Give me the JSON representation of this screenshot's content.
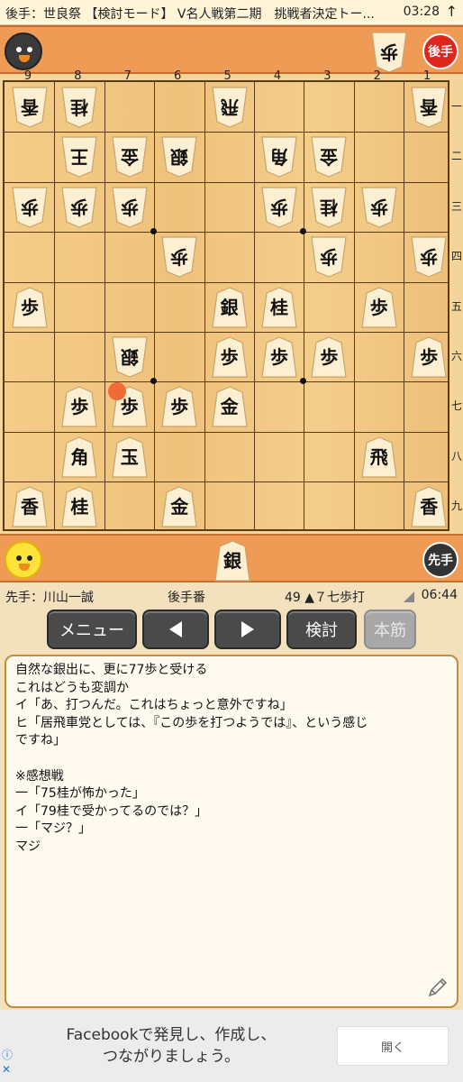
{
  "status_bar": {
    "title": "後手：世良祭 【検討モード】 V名人戦第二期　挑戦者決定トー...",
    "time": "03:28",
    "arrow": "↑"
  },
  "gote": {
    "badge": "後手",
    "hand": [
      "歩"
    ]
  },
  "sente": {
    "badge": "先手",
    "hand": [
      "銀"
    ]
  },
  "board": {
    "col_labels": [
      "9",
      "8",
      "7",
      "6",
      "5",
      "4",
      "3",
      "2",
      "1"
    ],
    "row_labels": [
      "一",
      "二",
      "三",
      "四",
      "五",
      "六",
      "七",
      "八",
      "九"
    ],
    "pieces": [
      {
        "file": 9,
        "rank": 1,
        "char": "香",
        "owner": "gote"
      },
      {
        "file": 8,
        "rank": 1,
        "char": "桂",
        "owner": "gote"
      },
      {
        "file": 5,
        "rank": 1,
        "char": "飛",
        "owner": "gote"
      },
      {
        "file": 1,
        "rank": 1,
        "char": "香",
        "owner": "gote"
      },
      {
        "file": 8,
        "rank": 2,
        "char": "王",
        "owner": "gote"
      },
      {
        "file": 7,
        "rank": 2,
        "char": "金",
        "owner": "gote"
      },
      {
        "file": 6,
        "rank": 2,
        "char": "銀",
        "owner": "gote"
      },
      {
        "file": 4,
        "rank": 2,
        "char": "角",
        "owner": "gote"
      },
      {
        "file": 3,
        "rank": 2,
        "char": "金",
        "owner": "gote"
      },
      {
        "file": 9,
        "rank": 3,
        "char": "歩",
        "owner": "gote"
      },
      {
        "file": 8,
        "rank": 3,
        "char": "歩",
        "owner": "gote"
      },
      {
        "file": 7,
        "rank": 3,
        "char": "歩",
        "owner": "gote"
      },
      {
        "file": 4,
        "rank": 3,
        "char": "歩",
        "owner": "gote"
      },
      {
        "file": 3,
        "rank": 3,
        "char": "桂",
        "owner": "gote"
      },
      {
        "file": 2,
        "rank": 3,
        "char": "歩",
        "owner": "gote"
      },
      {
        "file": 6,
        "rank": 4,
        "char": "歩",
        "owner": "gote"
      },
      {
        "file": 3,
        "rank": 4,
        "char": "歩",
        "owner": "gote"
      },
      {
        "file": 1,
        "rank": 4,
        "char": "歩",
        "owner": "gote"
      },
      {
        "file": 9,
        "rank": 5,
        "char": "歩",
        "owner": "sente"
      },
      {
        "file": 5,
        "rank": 5,
        "char": "銀",
        "owner": "sente"
      },
      {
        "file": 4,
        "rank": 5,
        "char": "桂",
        "owner": "sente"
      },
      {
        "file": 2,
        "rank": 5,
        "char": "歩",
        "owner": "sente"
      },
      {
        "file": 7,
        "rank": 6,
        "char": "銀",
        "owner": "gote"
      },
      {
        "file": 5,
        "rank": 6,
        "char": "歩",
        "owner": "sente"
      },
      {
        "file": 4,
        "rank": 6,
        "char": "歩",
        "owner": "sente"
      },
      {
        "file": 3,
        "rank": 6,
        "char": "歩",
        "owner": "sente"
      },
      {
        "file": 1,
        "rank": 6,
        "char": "歩",
        "owner": "sente"
      },
      {
        "file": 8,
        "rank": 7,
        "char": "歩",
        "owner": "sente"
      },
      {
        "file": 7,
        "rank": 7,
        "char": "歩",
        "owner": "sente"
      },
      {
        "file": 6,
        "rank": 7,
        "char": "歩",
        "owner": "sente"
      },
      {
        "file": 5,
        "rank": 7,
        "char": "金",
        "owner": "sente"
      },
      {
        "file": 8,
        "rank": 8,
        "char": "角",
        "owner": "sente"
      },
      {
        "file": 7,
        "rank": 8,
        "char": "玉",
        "owner": "sente"
      },
      {
        "file": 2,
        "rank": 8,
        "char": "飛",
        "owner": "sente"
      },
      {
        "file": 9,
        "rank": 9,
        "char": "香",
        "owner": "sente"
      },
      {
        "file": 8,
        "rank": 9,
        "char": "桂",
        "owner": "sente"
      },
      {
        "file": 6,
        "rank": 9,
        "char": "金",
        "owner": "sente"
      },
      {
        "file": 1,
        "rank": 9,
        "char": "香",
        "owner": "sente"
      }
    ],
    "last_move": {
      "file": 7,
      "rank": 7
    }
  },
  "info": {
    "sente_name": "先手：川山一誠",
    "turn": "後手番",
    "move": "49 ▲７七歩打",
    "clock": "06:44"
  },
  "toolbar": {
    "menu": "メニュー",
    "analyze": "検討",
    "mainline": "本筋"
  },
  "comment": {
    "lines": [
      "自然な銀出に、更に77歩と受ける",
      "これはどうも変調か",
      "イ「あ、打つんだ。これはちょっと意外ですね」",
      "ヒ「居飛車党としては、『この歩を打つようでは』、という感じ",
      "ですね」",
      "",
      "※感想戦",
      "一「75桂が怖かった」",
      "イ「79桂で受かってるのでは？」",
      "一「マジ？」",
      "マジ"
    ]
  },
  "ad": {
    "text_line1": "Facebookで発見し、作成し、",
    "text_line2": "つながりましょう。",
    "button": "開く",
    "info_icon": "ⓘ",
    "close_icon": "✕"
  },
  "colors": {
    "hand_area": "#ef9a55",
    "board": "#f4cc87",
    "last_move": "#f06a36",
    "gote_badge": "#e0261c"
  }
}
